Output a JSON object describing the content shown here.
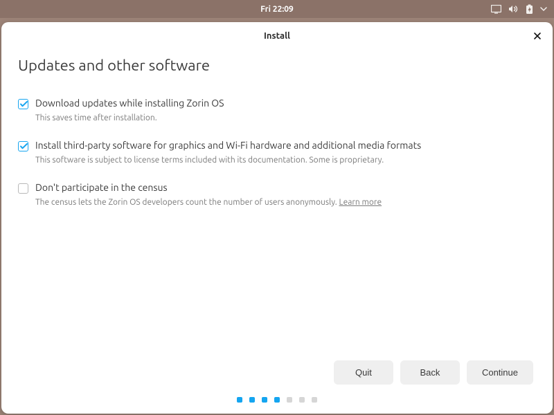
{
  "topbar": {
    "clock": "Fri 22:09"
  },
  "window": {
    "title": "Install"
  },
  "page": {
    "heading": "Updates and other software"
  },
  "options": [
    {
      "checked": true,
      "label": "Download updates while installing Zorin OS",
      "desc": "This saves time after installation."
    },
    {
      "checked": true,
      "label": "Install third-party software for graphics and Wi-Fi hardware and additional media formats",
      "desc": "This software is subject to license terms included with its documentation. Some is proprietary."
    },
    {
      "checked": false,
      "label": "Don't participate in the census",
      "desc": "The census lets the Zorin OS developers count the number of users anonymously.  ",
      "link": "Learn more"
    }
  ],
  "buttons": {
    "quit": "Quit",
    "back": "Back",
    "continue": "Continue"
  },
  "progress": {
    "total": 7,
    "done": 4
  },
  "colors": {
    "accent": "#15a5f0"
  }
}
